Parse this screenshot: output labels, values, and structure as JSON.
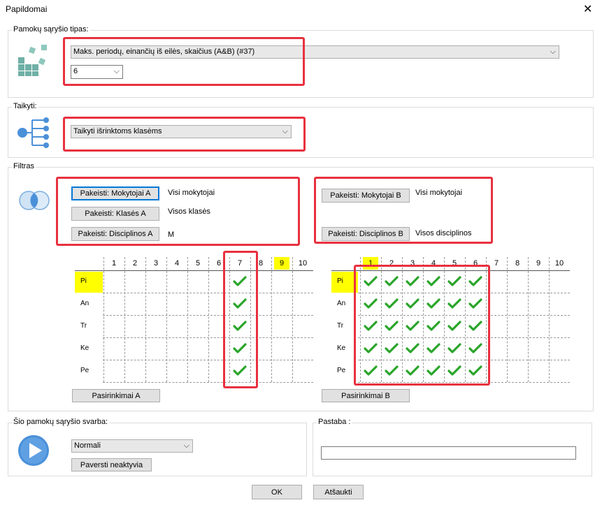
{
  "window": {
    "title": "Papildomai",
    "close_glyph": "✕"
  },
  "relation_type": {
    "label": "Pamokų sąryšio tipas:",
    "type_value": "Maks. periodų, einančių iš eilės, skaičius (A&B) (#37)",
    "number_value": "6"
  },
  "apply": {
    "label": "Taikyti:",
    "value": "Taikyti išrinktoms klasėms"
  },
  "filter": {
    "label": "Filtras",
    "a": {
      "teachers_button": "Pakeisti: Mokytojai A",
      "teachers_value": "Visi mokytojai",
      "classes_button": "Pakeisti: Klasės A",
      "classes_value": "Visos klasės",
      "subjects_button": "Pakeisti: Disciplinos A",
      "subjects_value": "M"
    },
    "b": {
      "teachers_button": "Pakeisti: Mokytojai B",
      "teachers_value": "Visi mokytojai",
      "subjects_button": "Pakeisti: Disciplinos B",
      "subjects_value": "Visos disciplinos"
    }
  },
  "grid_a": {
    "columns": [
      "1",
      "2",
      "3",
      "4",
      "5",
      "6",
      "7",
      "8",
      "9",
      "10"
    ],
    "highlight_col": "9",
    "rows": [
      "Pi",
      "An",
      "Tr",
      "Ke",
      "Pe"
    ],
    "highlight_row": "Pi",
    "checked": [
      [
        7
      ],
      [
        7
      ],
      [
        7
      ],
      [
        7
      ],
      [
        7
      ]
    ],
    "button": "Pasirinkimai A"
  },
  "grid_b": {
    "columns": [
      "1",
      "2",
      "3",
      "4",
      "5",
      "6",
      "7",
      "8",
      "9",
      "10"
    ],
    "highlight_col": "1",
    "rows": [
      "Pi",
      "An",
      "Tr",
      "Ke",
      "Pe"
    ],
    "highlight_row": "Pi",
    "checked": [
      [
        1,
        2,
        3,
        4,
        5,
        6
      ],
      [
        1,
        2,
        3,
        4,
        5,
        6
      ],
      [
        1,
        2,
        3,
        4,
        5,
        6
      ],
      [
        1,
        2,
        3,
        4,
        5,
        6
      ],
      [
        1,
        2,
        3,
        4,
        5,
        6
      ]
    ],
    "button": "Pasirinkimai B"
  },
  "importance": {
    "label": "Šio pamokų sąryšio svarba:",
    "value": "Normali",
    "deactivate_button": "Paversti neaktyvia"
  },
  "note": {
    "label": "Pastaba :",
    "value": ""
  },
  "footer": {
    "ok": "OK",
    "cancel": "Atšaukti"
  },
  "colors": {
    "highlight": "#ffff00",
    "check": "#2aa52a",
    "annotation": "#e8313f",
    "play": "#4a90d9"
  }
}
